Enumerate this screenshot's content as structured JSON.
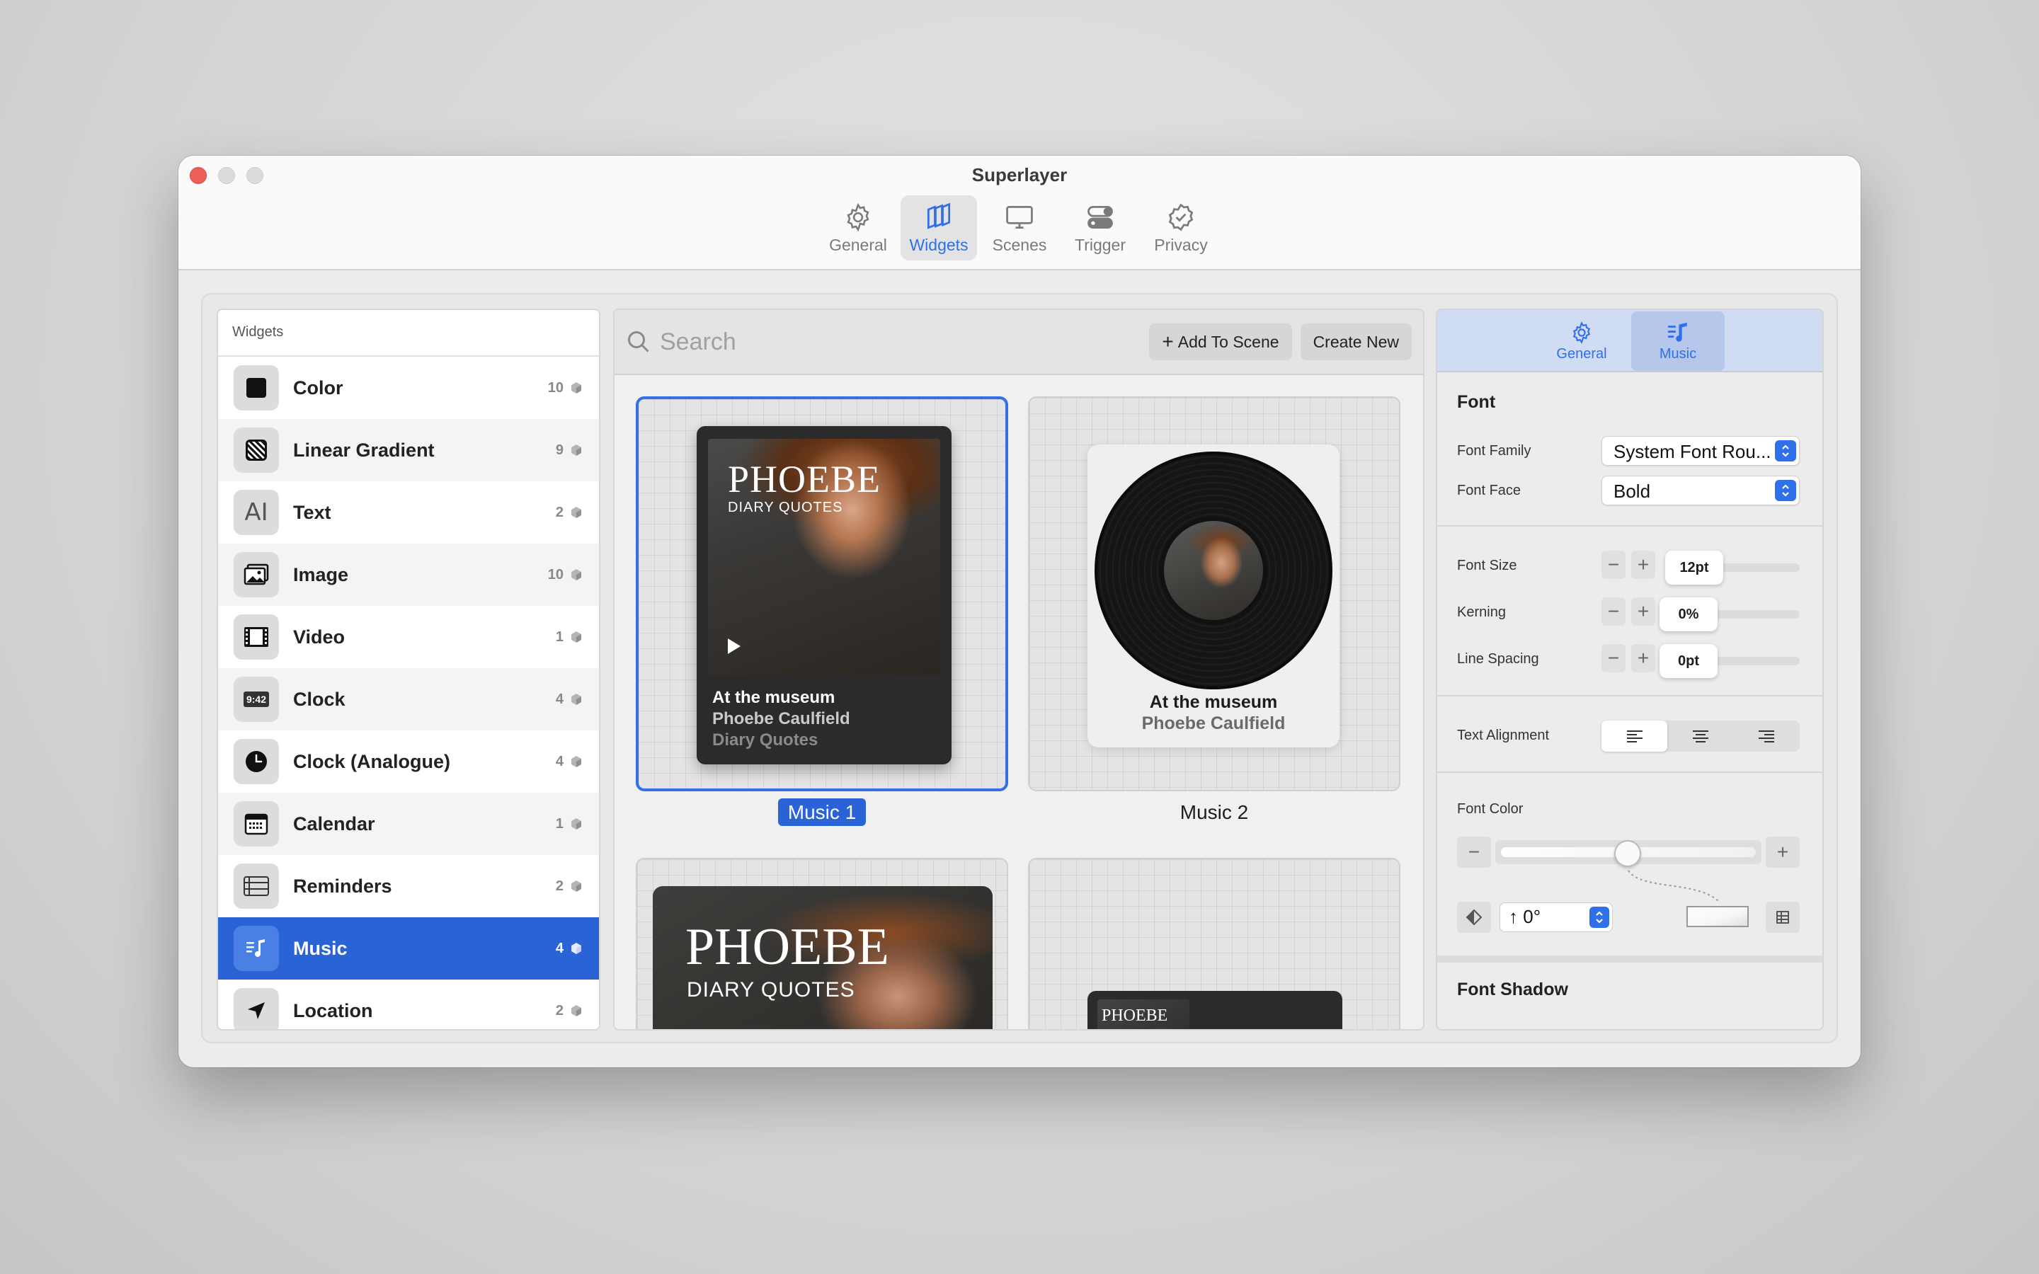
{
  "window": {
    "title": "Superlayer"
  },
  "toolbar": {
    "items": [
      {
        "label": "General",
        "icon": "gear-icon"
      },
      {
        "label": "Widgets",
        "icon": "widgets-icon"
      },
      {
        "label": "Scenes",
        "icon": "monitor-icon"
      },
      {
        "label": "Trigger",
        "icon": "toggle-icon"
      },
      {
        "label": "Privacy",
        "icon": "shield-check-icon"
      }
    ],
    "active": "Widgets"
  },
  "sidebar": {
    "header": "Widgets",
    "items": [
      {
        "label": "Color",
        "count": "10",
        "icon": "color-square-icon"
      },
      {
        "label": "Linear Gradient",
        "count": "9",
        "icon": "gradient-icon"
      },
      {
        "label": "Text",
        "count": "2",
        "icon": "text-cursor-icon"
      },
      {
        "label": "Image",
        "count": "10",
        "icon": "photo-icon"
      },
      {
        "label": "Video",
        "count": "1",
        "icon": "film-icon"
      },
      {
        "label": "Clock",
        "count": "4",
        "icon": "digital-clock-icon"
      },
      {
        "label": "Clock (Analogue)",
        "count": "4",
        "icon": "analog-clock-icon"
      },
      {
        "label": "Calendar",
        "count": "1",
        "icon": "calendar-icon"
      },
      {
        "label": "Reminders",
        "count": "2",
        "icon": "list-icon"
      },
      {
        "label": "Music",
        "count": "4",
        "icon": "music-note-icon"
      },
      {
        "label": "Location",
        "count": "2",
        "icon": "location-arrow-icon"
      }
    ],
    "selected": "Music",
    "time_icon_text": "9:42"
  },
  "gallery": {
    "search_placeholder": "Search",
    "add_to_scene": "Add To Scene",
    "create_new": "Create New",
    "cards": [
      {
        "name": "Music 1",
        "selected": true
      },
      {
        "name": "Music 2",
        "selected": false
      }
    ],
    "widget": {
      "title": "PHOEBE",
      "subtitle": "DIARY QUOTES",
      "track": "At the museum",
      "artist": "Phoebe Caulfield",
      "album": "Diary Quotes"
    }
  },
  "inspector": {
    "tabs": [
      {
        "label": "General",
        "icon": "gear-icon"
      },
      {
        "label": "Music",
        "icon": "music-list-icon"
      }
    ],
    "active_tab": "Music",
    "font_section": "Font",
    "font_family_label": "Font Family",
    "font_family_value": "System Font Rou...",
    "font_face_label": "Font Face",
    "font_face_value": "Bold",
    "font_size_label": "Font Size",
    "font_size_value": "12pt",
    "kerning_label": "Kerning",
    "kerning_value": "0%",
    "line_spacing_label": "Line Spacing",
    "line_spacing_value": "0pt",
    "text_alignment_label": "Text Alignment",
    "text_alignment_value": "left",
    "font_color_label": "Font Color",
    "font_color_level": 0.41,
    "angle_value": "0°",
    "font_shadow_section": "Font Shadow",
    "colors": {
      "accent": "#2f6fe8",
      "selection": "#2a63d6"
    }
  }
}
